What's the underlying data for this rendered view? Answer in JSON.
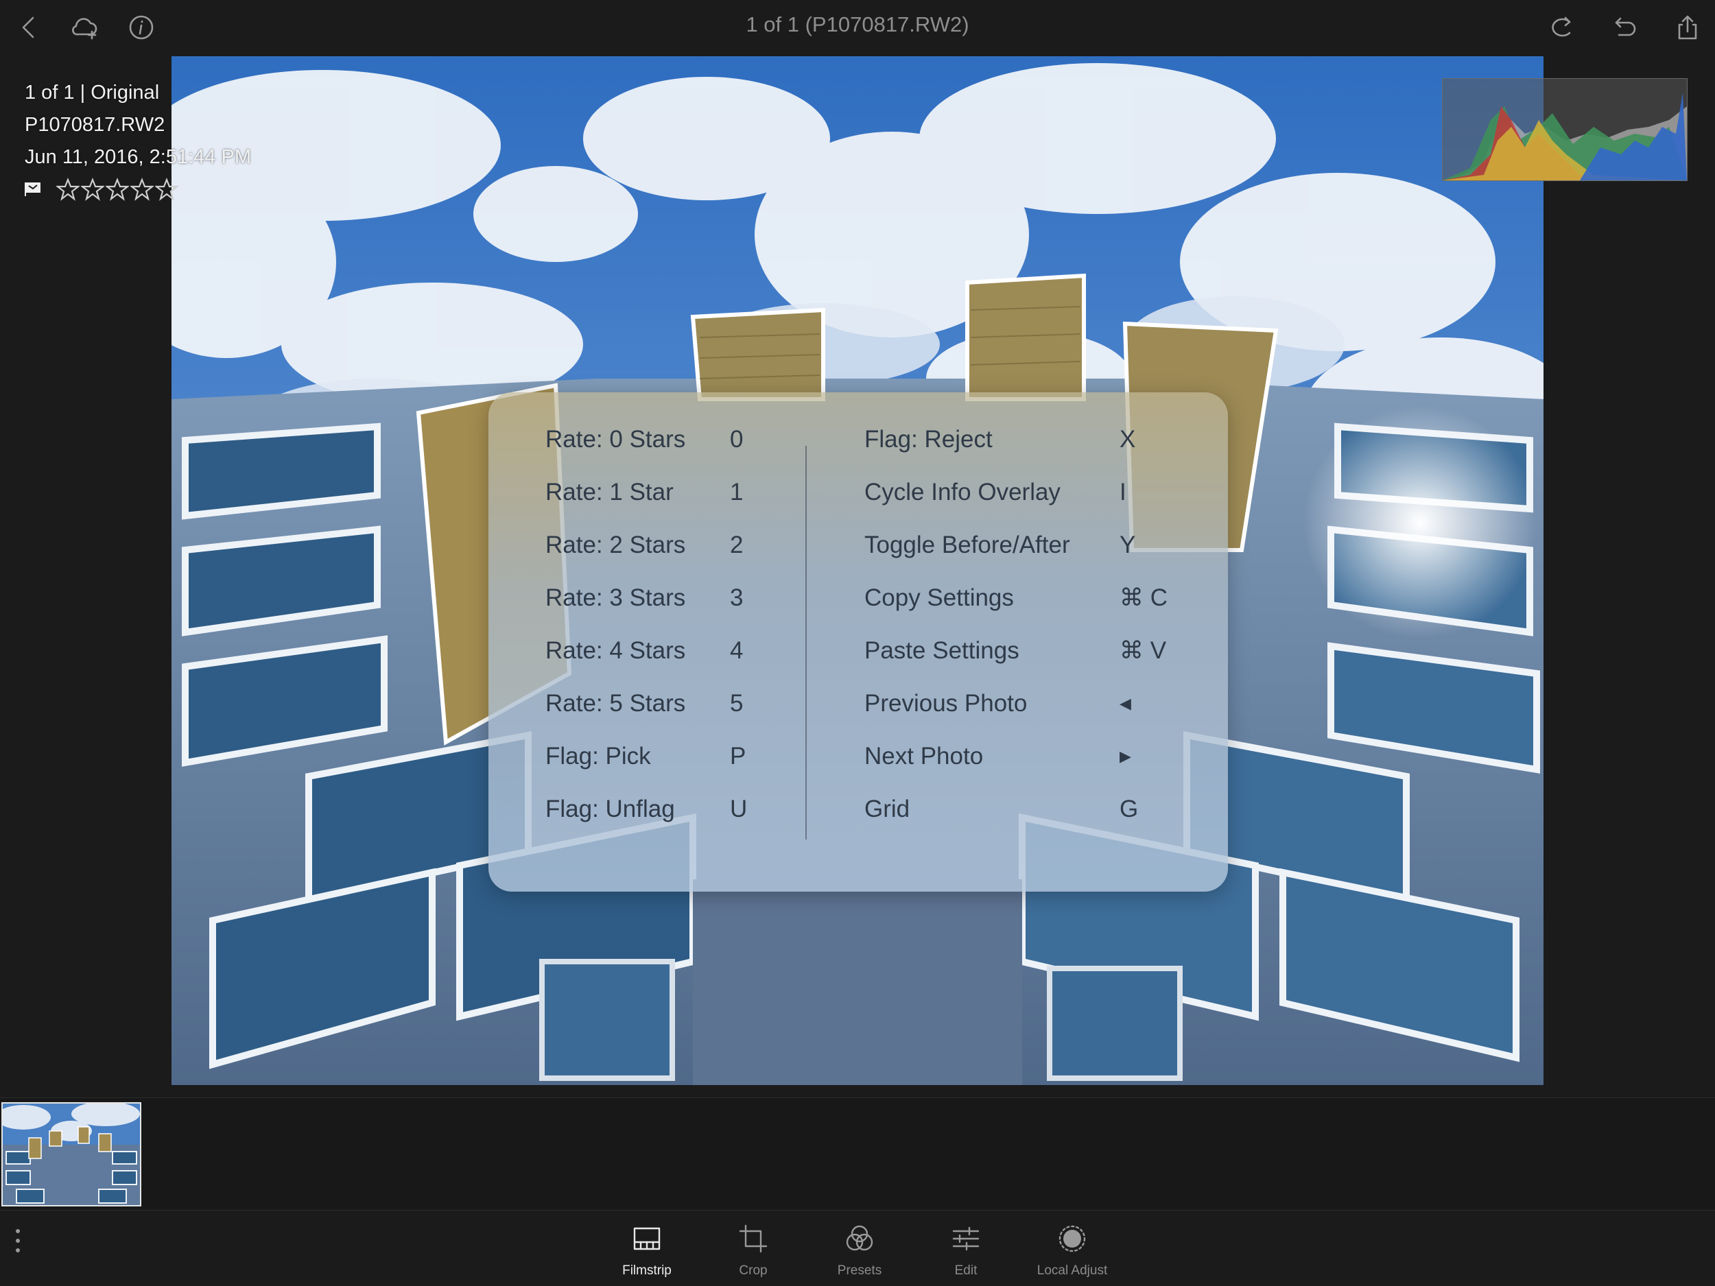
{
  "header": {
    "title": "1 of 1 (P1070817.RW2)",
    "left_icons": [
      "back-icon",
      "cloud-add-icon",
      "info-icon"
    ],
    "right_icons": [
      "redo-icon",
      "undo-icon",
      "share-icon"
    ]
  },
  "info_overlay": {
    "position": "1 of 1 | Original",
    "filename": "P1070817.RW2",
    "datetime": "Jun 11, 2016, 2:51:44 PM",
    "rating": 0,
    "max_rating": 5
  },
  "shortcuts": {
    "left": [
      {
        "label": "Rate: 0 Stars",
        "key": "0"
      },
      {
        "label": "Rate: 1 Star",
        "key": "1"
      },
      {
        "label": "Rate: 2 Stars",
        "key": "2"
      },
      {
        "label": "Rate: 3 Stars",
        "key": "3"
      },
      {
        "label": "Rate: 4 Stars",
        "key": "4"
      },
      {
        "label": "Rate: 5 Stars",
        "key": "5"
      },
      {
        "label": "Flag: Pick",
        "key": "P"
      },
      {
        "label": "Flag: Unflag",
        "key": "U"
      }
    ],
    "right": [
      {
        "label": "Flag: Reject",
        "key": "X"
      },
      {
        "label": "Cycle Info Overlay",
        "key": "I"
      },
      {
        "label": "Toggle Before/After",
        "key": "Y"
      },
      {
        "label": "Copy Settings",
        "key": "⌘ C"
      },
      {
        "label": "Paste Settings",
        "key": "⌘ V"
      },
      {
        "label": "Previous Photo",
        "key": "◀"
      },
      {
        "label": "Next Photo",
        "key": "▶"
      },
      {
        "label": "Grid",
        "key": "G"
      }
    ]
  },
  "toolbar": {
    "tools": [
      {
        "label": "Filmstrip",
        "icon": "filmstrip-icon",
        "active": true
      },
      {
        "label": "Crop",
        "icon": "crop-icon",
        "active": false
      },
      {
        "label": "Presets",
        "icon": "presets-icon",
        "active": false
      },
      {
        "label": "Edit",
        "icon": "sliders-icon",
        "active": false
      },
      {
        "label": "Local Adjust",
        "icon": "local-adjust-icon",
        "active": false
      }
    ]
  },
  "colors": {
    "background": "#1b1b1b",
    "sky": "#3f78c2",
    "panel_text": "#2f3a48",
    "icon_gray": "#9a9a9a"
  }
}
